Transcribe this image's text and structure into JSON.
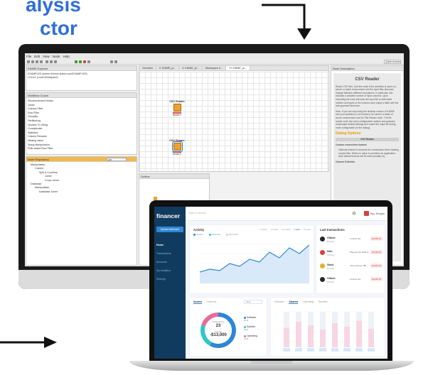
{
  "headline": {
    "line1": "alysis",
    "line2": "ctor"
  },
  "colors": {
    "headline": "#2f6fd6",
    "knime_node": "#f0a030",
    "sidebar": "#113b5e",
    "accent": "#2e87d6",
    "negative": "#d94040"
  },
  "knime": {
    "menu": [
      "File",
      "Edit",
      "View",
      "Node",
      "Help"
    ],
    "search_placeholder": "Quick Access",
    "explorer": {
      "title": "KNIME Explorer",
      "items": [
        "EXAMPLES (knime://knime.knime.com/EXAMPLES)",
        "LOCAL (Local Workspace)"
      ]
    },
    "coach": {
      "title": "Workflow Coach",
      "header": "Recommended Nodes",
      "items": [
        "Joiner",
        "Column Filter",
        "Row Filter",
        "GroupBy",
        "Partitioning",
        "Number To String",
        "Concatenate",
        "Statistics",
        "Column Rename",
        "Missing Value",
        "String Manipulation",
        "Rule-based Row Filter"
      ]
    },
    "repository": {
      "title": "Node Repository",
      "search_value": "join",
      "items": [
        "Manipulation",
        "Column",
        "Split & Combine",
        "Joiner",
        "Cross Joiner",
        "Database",
        "Manipulation",
        "Database Joiner"
      ]
    },
    "tabs": [
      "Overview",
      "0: KNIME_pr...",
      "0: KNIME_pr...",
      "Workspace &...",
      "*0: KNIME_pr..."
    ],
    "nodes": [
      {
        "title": "CSV Reader",
        "label": "Node 1"
      },
      {
        "title": "CSV Reader",
        "label": "Node 2"
      }
    ],
    "outline_title": "Outline",
    "description": {
      "panel_title": "Node Description",
      "title": "CSV Reader",
      "para1": "Reads CSV files. Use this node if the workflow is used in a server or batch environment and the input files structure change between different invocations. In particular, this includes a variable number of input columns. Upon executing the node will scan the input file to determine number and types of the columns and output a table with the auto-guessed structure.",
      "para2": "Note: If you are only using the desktop version of KNIME and your workflow is not meant to be used in a batch or server environment use the File Reader node. The file reader node has more configuration options and guesses meaningful default settings as it scans the input file during node configuration (in the dialog).",
      "options_heading": "Dialog Options",
      "bar": "CSV Reader",
      "opt_title": "Custom connection timeout",
      "opt_text": "Optional timeout in seconds for connections when reading remote files. When no value is provided, an application-wide default timeout will be used (usually 1s).",
      "opt_next": "Column Delimiter"
    }
  },
  "financer": {
    "logo": "financer",
    "upload_label": "Upload statement",
    "nav": [
      "Home",
      "Transactions",
      "Accounts",
      "My analytics",
      "Settings"
    ],
    "search_placeholder": "Type to search",
    "user": "Hey, Morgan",
    "activity": {
      "title": "Activity",
      "filters": [
        "1 week",
        "1 month",
        "3 months",
        "1 year",
        "5 years"
      ],
      "legend": [
        "Income",
        "Outcome",
        "Net worth"
      ]
    },
    "transactions": {
      "title": "Last transactions",
      "rows": [
        {
          "name": "Github",
          "sub": "Monthly",
          "desc": "License fee",
          "amount": "-$2,000.00"
        },
        {
          "name": "Nike",
          "sub": "Clothing",
          "desc": "Payment ID 4432 S",
          "amount": "-$2,000.00"
        },
        {
          "name": "Slack",
          "sub": "Monthly",
          "desc": "Team license  TBI",
          "amount": "-$2,000.00"
        },
        {
          "name": "Github",
          "sub": "Monthly",
          "desc": "License fee",
          "amount": "-$2,000.00"
        }
      ]
    },
    "income": {
      "tabs": [
        "Income",
        "Outcome"
      ],
      "select": "June",
      "center_label": "Transactions",
      "count": "23",
      "total_label": "Income",
      "total": "-$13,000",
      "legend": [
        {
          "name": "Software",
          "sub": "$245"
        },
        {
          "name": "Salaries",
          "sub": "$245"
        },
        {
          "name": "Operating",
          "sub": "$245"
        }
      ],
      "slices": [
        0.58,
        0.22,
        0.2
      ]
    },
    "budget": {
      "tabs": [
        "Software",
        "Salaries",
        "Operating",
        "Benefits"
      ],
      "active_tab": 1,
      "bars": [
        0.55,
        0.72,
        0.62,
        0.5,
        0.68,
        0.58,
        0.75,
        0.52
      ]
    }
  }
}
